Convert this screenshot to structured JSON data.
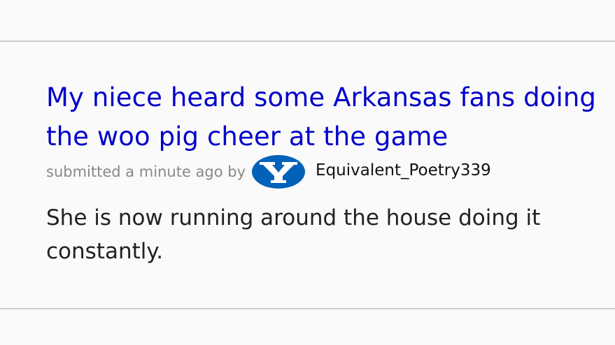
{
  "post": {
    "title": "My niece heard some Arkansas fans doing the woo pig cheer at the game",
    "tagline_prefix": "submitted a minute ago by",
    "author": "Equivalent_Poetry339",
    "body": "She is now running around the house doing it constantly."
  },
  "flair": {
    "icon": "byu-y-logo-icon",
    "color": "#0062b8"
  },
  "colors": {
    "title_link": "#0000cc",
    "tagline": "#888888",
    "body_text": "#222222",
    "background": "#fafafa",
    "divider": "#cfcfcf"
  }
}
